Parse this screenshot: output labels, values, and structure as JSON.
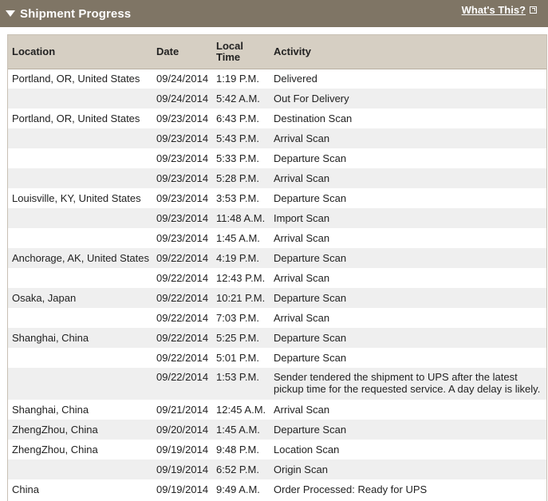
{
  "header": {
    "title": "Shipment Progress",
    "help_link": "What's This?"
  },
  "table": {
    "columns": [
      "Location",
      "Date",
      "Local Time",
      "Activity"
    ],
    "rows": [
      {
        "location": "Portland, OR, United States",
        "date": "09/24/2014",
        "time": "1:19 P.M.",
        "activity": "Delivered"
      },
      {
        "location": "",
        "date": "09/24/2014",
        "time": "5:42 A.M.",
        "activity": "Out For Delivery"
      },
      {
        "location": "Portland, OR, United States",
        "date": "09/23/2014",
        "time": "6:43 P.M.",
        "activity": "Destination Scan"
      },
      {
        "location": "",
        "date": "09/23/2014",
        "time": "5:43 P.M.",
        "activity": "Arrival Scan"
      },
      {
        "location": "",
        "date": "09/23/2014",
        "time": "5:33 P.M.",
        "activity": "Departure Scan"
      },
      {
        "location": "",
        "date": "09/23/2014",
        "time": "5:28 P.M.",
        "activity": "Arrival Scan"
      },
      {
        "location": "Louisville, KY, United States",
        "date": "09/23/2014",
        "time": "3:53 P.M.",
        "activity": "Departure Scan"
      },
      {
        "location": "",
        "date": "09/23/2014",
        "time": "11:48 A.M.",
        "activity": "Import Scan"
      },
      {
        "location": "",
        "date": "09/23/2014",
        "time": "1:45 A.M.",
        "activity": "Arrival Scan"
      },
      {
        "location": "Anchorage, AK, United States",
        "date": "09/22/2014",
        "time": "4:19 P.M.",
        "activity": "Departure Scan"
      },
      {
        "location": "",
        "date": "09/22/2014",
        "time": "12:43 P.M.",
        "activity": "Arrival Scan"
      },
      {
        "location": "Osaka, Japan",
        "date": "09/22/2014",
        "time": "10:21 P.M.",
        "activity": "Departure Scan"
      },
      {
        "location": "",
        "date": "09/22/2014",
        "time": "7:03 P.M.",
        "activity": "Arrival Scan"
      },
      {
        "location": "Shanghai, China",
        "date": "09/22/2014",
        "time": "5:25 P.M.",
        "activity": "Departure Scan"
      },
      {
        "location": "",
        "date": "09/22/2014",
        "time": "5:01 P.M.",
        "activity": "Departure Scan"
      },
      {
        "location": "",
        "date": "09/22/2014",
        "time": "1:53 P.M.",
        "activity": "Sender tendered the shipment to UPS after the latest pickup time for the requested service. A day delay is likely."
      },
      {
        "location": "Shanghai, China",
        "date": "09/21/2014",
        "time": "12:45 A.M.",
        "activity": "Arrival Scan"
      },
      {
        "location": "ZhengZhou, China",
        "date": "09/20/2014",
        "time": "1:45 A.M.",
        "activity": "Departure Scan"
      },
      {
        "location": "ZhengZhou, China",
        "date": "09/19/2014",
        "time": "9:48 P.M.",
        "activity": "Location Scan"
      },
      {
        "location": "",
        "date": "09/19/2014",
        "time": "6:52 P.M.",
        "activity": "Origin Scan"
      },
      {
        "location": "China",
        "date": "09/19/2014",
        "time": "9:49 A.M.",
        "activity": "Order Processed: Ready for UPS"
      }
    ]
  }
}
